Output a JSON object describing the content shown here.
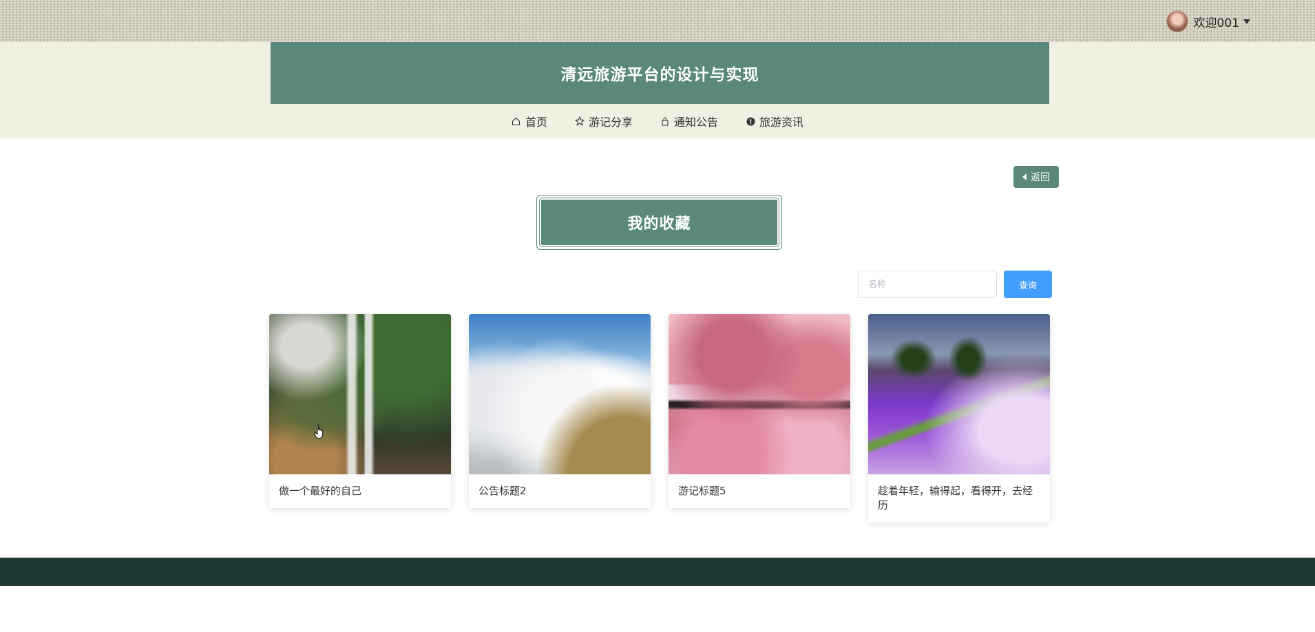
{
  "user": {
    "welcome": "欢迎001",
    "avatar_icon": "user-avatar"
  },
  "header": {
    "site_title": "清远旅游平台的设计与实现",
    "accent_color": "#5a887b"
  },
  "nav": {
    "items": [
      {
        "label": "首页",
        "icon": "home-icon"
      },
      {
        "label": "游记分享",
        "icon": "star-icon"
      },
      {
        "label": "通知公告",
        "icon": "bag-icon"
      },
      {
        "label": "旅游资讯",
        "icon": "info-icon"
      }
    ]
  },
  "main": {
    "back_label": "返回",
    "section_title": "我的收藏",
    "search": {
      "placeholder": "名称",
      "value": "",
      "button_label": "查询",
      "button_color": "#409eff"
    },
    "cards": [
      {
        "title": "做一个最好的自己",
        "image": "waterfall"
      },
      {
        "title": "公告标题2",
        "image": "clouds"
      },
      {
        "title": "游记标题5",
        "image": "pink-volcano"
      },
      {
        "title": "趁着年轻，输得起，看得开，去经历",
        "image": "lavender-field"
      }
    ]
  },
  "footer": {
    "color": "#1f3a34"
  }
}
